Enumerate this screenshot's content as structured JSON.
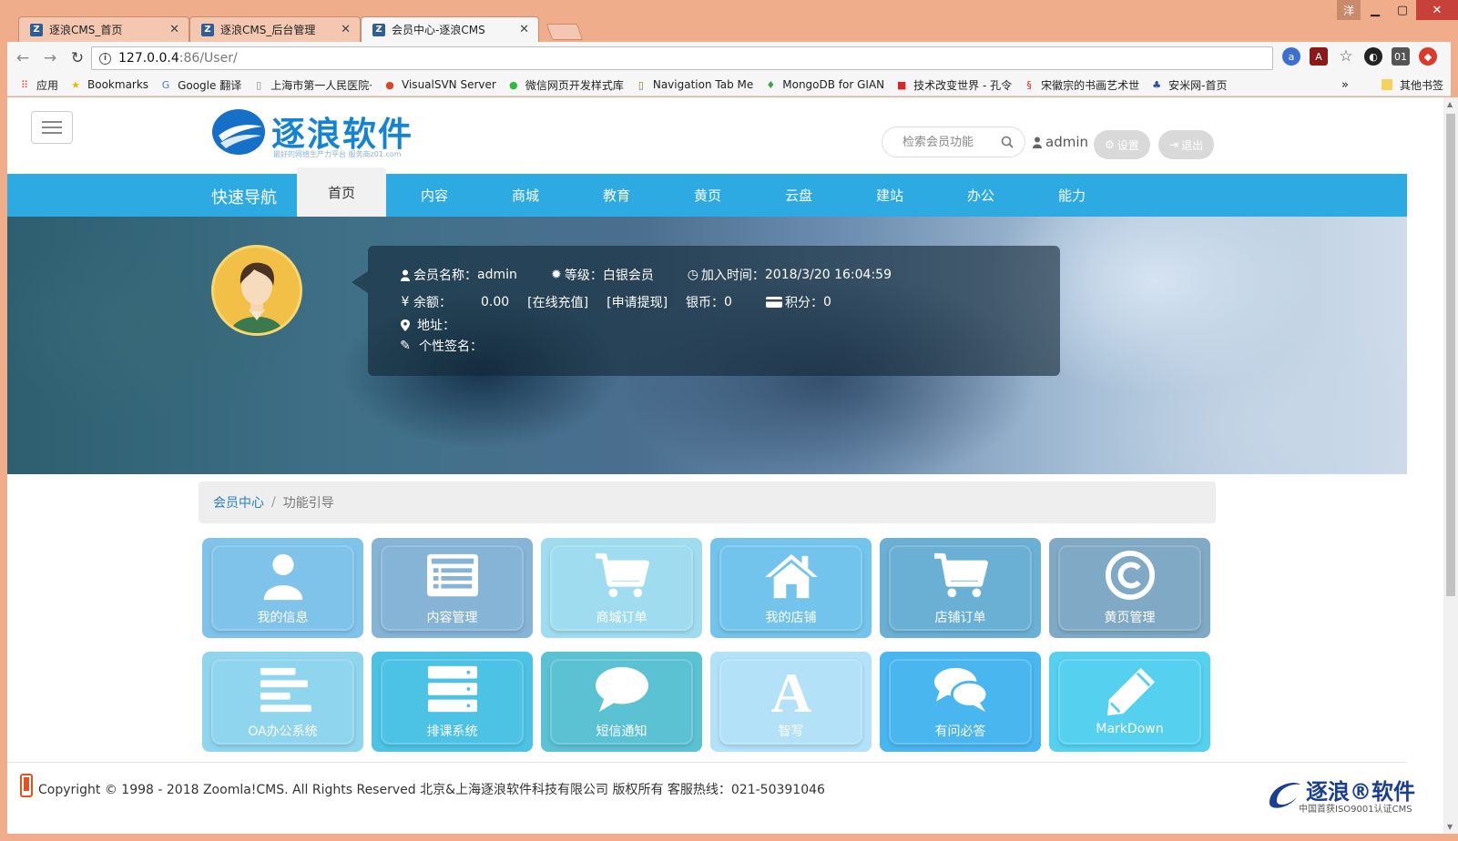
{
  "browser": {
    "tabs": [
      {
        "title": "逐浪CMS_首页",
        "favicon": "Z"
      },
      {
        "title": "逐浪CMS_后台管理",
        "favicon": "Z"
      },
      {
        "title": "会员中心-逐浪CMS",
        "favicon": "Z"
      }
    ],
    "user_badge": "洋",
    "url_host": "127.0.0.4",
    "url_path": ":86/User/",
    "bookmarks": [
      {
        "label": "应用",
        "icon": "apps-grid-icon",
        "color": "#e04a3f"
      },
      {
        "label": "Bookmarks",
        "icon": "star-icon",
        "color": "#f2b705"
      },
      {
        "label": "Google 翻译",
        "icon": "translate-icon",
        "color": "#4a7bd0"
      },
      {
        "label": "上海市第一人民医院·",
        "icon": "page-icon",
        "color": "#888888"
      },
      {
        "label": "VisualSVN Server",
        "icon": "chrome-icon",
        "color": "#d9472b"
      },
      {
        "label": "微信网页开发样式库",
        "icon": "wechat-icon",
        "color": "#2dbb3f"
      },
      {
        "label": "Navigation Tab Me",
        "icon": "page-icon",
        "color": "#8a6a4a"
      },
      {
        "label": "MongoDB for GIAN",
        "icon": "leaf-icon",
        "color": "#3aa845"
      },
      {
        "label": "技术改变世界 - 孔令",
        "icon": "flag-icon",
        "color": "#d8262b"
      },
      {
        "label": "宋徽宗的书画艺术世",
        "icon": "seal-icon",
        "color": "#d8262b"
      },
      {
        "label": "安米网-首页",
        "icon": "paw-icon",
        "color": "#2a4aa0"
      }
    ],
    "bookmarks_more": "»",
    "bookmarks_other": "其他书签"
  },
  "header": {
    "logo_text": "逐浪软件",
    "logo_sub": "最好的网络生产力平台 服务商z01.com",
    "search_placeholder": "检索会员功能",
    "username": "admin",
    "settings_label": "设置",
    "logout_label": "退出"
  },
  "nav": {
    "title": "快速导航",
    "items": [
      "首页",
      "内容",
      "商城",
      "教育",
      "黄页",
      "云盘",
      "建站",
      "办公",
      "能力"
    ],
    "active_index": 0
  },
  "profile": {
    "name_label": "会员名称：",
    "name": "admin",
    "level_label": "等级：",
    "level": "白银会员",
    "join_label": "加入时间：",
    "join_time": "2018/3/20 16:04:59",
    "balance_label": "余额：",
    "balance": "0.00",
    "recharge": "[在线充值]",
    "withdraw": "[申请提现]",
    "silver_label": "银币：",
    "silver": "0",
    "points_label": "积分：",
    "points": "0",
    "address_label": "地址：",
    "signature_label": "个性签名："
  },
  "breadcrumb": {
    "root": "会员中心",
    "separator": "/",
    "current": "功能引导"
  },
  "tiles": [
    {
      "label": "我的信息",
      "icon": "user-icon",
      "color": "#7fc3ea"
    },
    {
      "label": "内容管理",
      "icon": "list-icon",
      "color": "#86b4d6"
    },
    {
      "label": "商城订单",
      "icon": "cart-icon",
      "color": "#9fdcef"
    },
    {
      "label": "我的店铺",
      "icon": "home-icon",
      "color": "#73c4ec"
    },
    {
      "label": "店铺订单",
      "icon": "cart-icon",
      "color": "#6ab0d4"
    },
    {
      "label": "黄页管理",
      "icon": "copyright-icon",
      "color": "#7fa9c5"
    },
    {
      "label": "OA办公系统",
      "icon": "align-left-icon",
      "color": "#8fd5ee"
    },
    {
      "label": "排课系统",
      "icon": "server-icon",
      "color": "#4cc3e4"
    },
    {
      "label": "短信通知",
      "icon": "comment-icon",
      "color": "#5bc2d4"
    },
    {
      "label": "智写",
      "icon": "font-icon",
      "color": "#b3e1f8"
    },
    {
      "label": "有问必答",
      "icon": "comments-icon",
      "color": "#4ab6ef"
    },
    {
      "label": "MarkDown",
      "icon": "pencil-icon",
      "color": "#55d1ef"
    }
  ],
  "footer": {
    "copyright": "Copyright © 1998 - 2018 Zoomla!CMS. All Rights Reserved 北京&上海逐浪软件科技有限公司 版权所有 客服热线：021-50391046",
    "logo_text": "逐浪®软件",
    "logo_sub": "中国首获ISO9001认证CMS"
  }
}
